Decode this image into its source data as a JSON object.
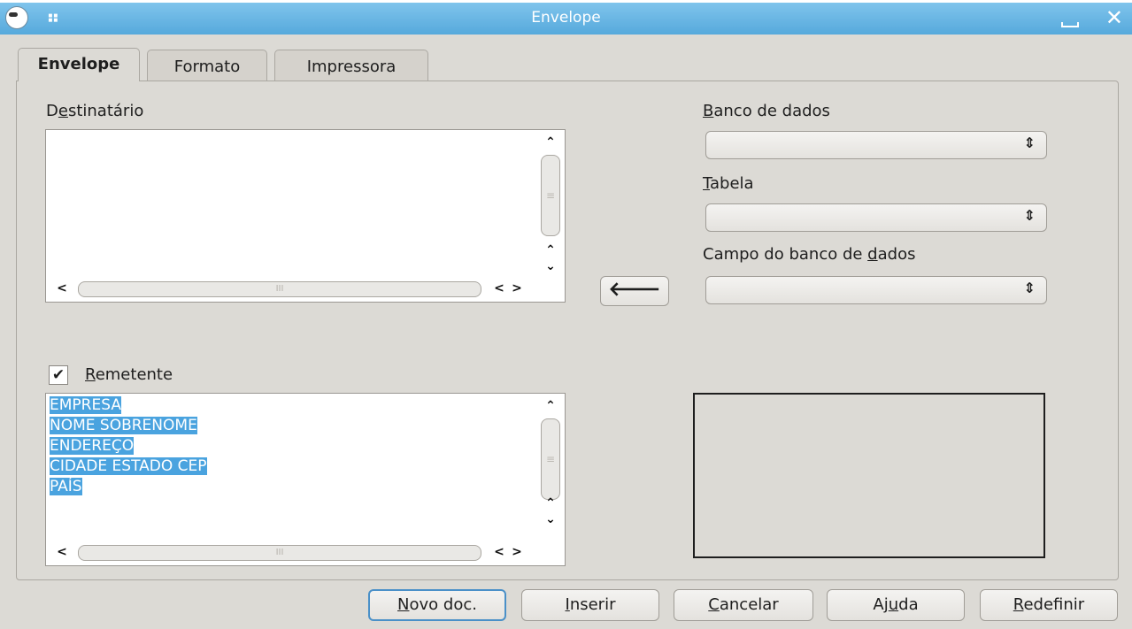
{
  "window": {
    "title": "Envelope"
  },
  "tabs": [
    {
      "label": "Envelope",
      "active": true
    },
    {
      "label": "Formato",
      "active": false
    },
    {
      "label": "Impressora",
      "active": false
    }
  ],
  "recipient": {
    "label_pre": "D",
    "label_ul": "e",
    "label_post": "stinatário",
    "value": ""
  },
  "database": {
    "label_ul": "B",
    "label_post": "anco de dados",
    "table_label_ul": "T",
    "table_label_post": "abela",
    "field_label_pre": "Campo do banco de ",
    "field_label_ul": "d",
    "field_label_post": "ados"
  },
  "sender": {
    "checked": true,
    "check_mark": "✔",
    "label_ul": "R",
    "label_post": "emetente",
    "lines": [
      "EMPRESA",
      "NOME SOBRENOME",
      "ENDEREÇO",
      "CIDADE ESTADO CEP",
      "PAÍS"
    ]
  },
  "scroll_glyphs": {
    "up": "⌃",
    "down": "⌄",
    "left": "<",
    "right": ">",
    "thumb_h": "III",
    "thumb_v": "≡"
  },
  "buttons": {
    "novo_pre": "",
    "novo_ul": "N",
    "novo_post": "ovo doc.",
    "inserir_pre": "",
    "inserir_ul": "I",
    "inserir_post": "nserir",
    "cancelar_pre": "",
    "cancelar_ul": "C",
    "cancelar_post": "ancelar",
    "ajuda_pre": "Aj",
    "ajuda_ul": "u",
    "ajuda_post": "da",
    "redefinir_pre": "",
    "redefinir_ul": "R",
    "redefinir_post": "edefinir",
    "insert_arrow": "🡐"
  },
  "colors": {
    "titlebar": "#56a9dc",
    "selection": "#4aa3df",
    "dialog_bg": "#dcdad5"
  },
  "icons": [
    "app-icon",
    "grip-icon",
    "minimize-icon",
    "close-icon",
    "arrow-left-icon",
    "checkmark-icon",
    "chevron-updown-icon"
  ]
}
